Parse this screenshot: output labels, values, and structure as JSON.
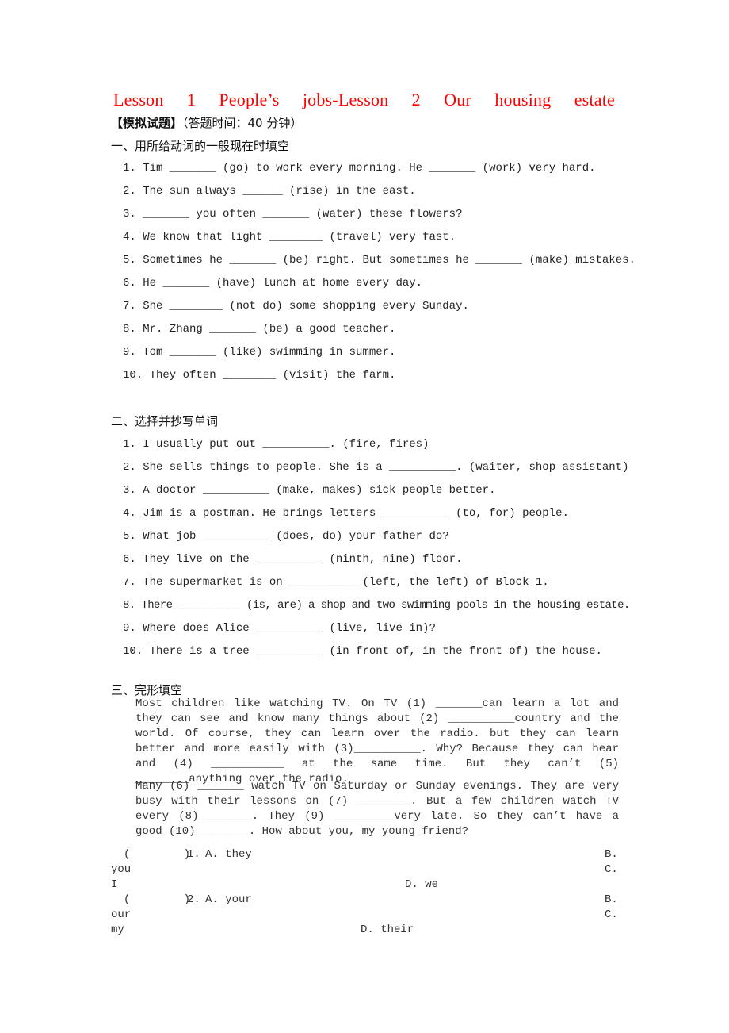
{
  "document": {
    "title_words": [
      "Lesson",
      "1",
      "People’s",
      "jobs-Lesson",
      "2",
      "Our",
      "housing",
      "estate"
    ],
    "title_color": "#ff0000",
    "subtitle_bracket": "【模拟试题】",
    "subtitle_time": "（答题时间：40 分钟）",
    "section1": {
      "heading": "一、用所给动词的一般现在时填空",
      "items": [
        "1. Tim _______ (go) to work every morning. He _______ (work) very hard.",
        "2. The sun always ______ (rise) in the east.",
        "3. _______ you often _______ (water) these flowers?",
        "4. We know that light ________ (travel) very fast.",
        "5. Sometimes he _______ (be) right. But sometimes he _______ (make) mistakes.",
        "6. He _______ (have) lunch at home every day.",
        "7. She ________ (not do) some shopping every Sunday.",
        "8. Mr. Zhang _______ (be) a good teacher.",
        "9. Tom _______ (like) swimming in summer.",
        "10. They often ________ (visit) the farm."
      ]
    },
    "section2": {
      "heading": "二、选择并抄写单词",
      "items": [
        "1. I usually put out __________. (fire, fires)",
        "2. She sells things to people. She is a __________. (waiter, shop assistant)",
        "3. A doctor __________ (make, makes) sick people better.",
        "4. Jim is a postman. He brings letters __________ (to, for) people.",
        "5. What job __________ (does, do) your father do?",
        "6. They live on the __________ (ninth, nine) floor.",
        "7. The supermarket is on __________ (left, the left) of Block 1.",
        "8. There __________ (is, are) a shop and two swimming pools in the housing estate.",
        "9. Where does Alice __________ (live, live in)?",
        "10. There is a tree __________ (in front of, in the front of) the house."
      ]
    },
    "section3": {
      "heading": "三、完形填空",
      "paragraph1": "Most children like watching TV. On TV (1) _______can learn a lot and they can see and know many things about (2) __________country and the world. Of course, they can learn over the radio. but they can learn better and more easily with (3)__________. Why? Because they can hear and (4) ___________ at the same time. But they can’t (5) ________anything over the radio.",
      "paragraph2": "Many (6) _______ watch TV on Saturday or Sunday evenings. They are very busy with their lessons on (7) ________. But a few children watch TV every (8)________. They (9) _________very late. So they can’t have a good (10)________. How about you, my young friend?",
      "questions": [
        {
          "paren": "(        )",
          "number": "1.",
          "A": "A. they",
          "B_label": "B.",
          "B_value": "you",
          "C_label": "C.",
          "C_value": "I",
          "D": "D. we"
        },
        {
          "paren": "(        )",
          "number": "2.",
          "A": "A. your",
          "B_label": "B.",
          "B_value": "our",
          "C_label": "C.",
          "C_value": "my",
          "D": "D. their"
        }
      ]
    }
  }
}
